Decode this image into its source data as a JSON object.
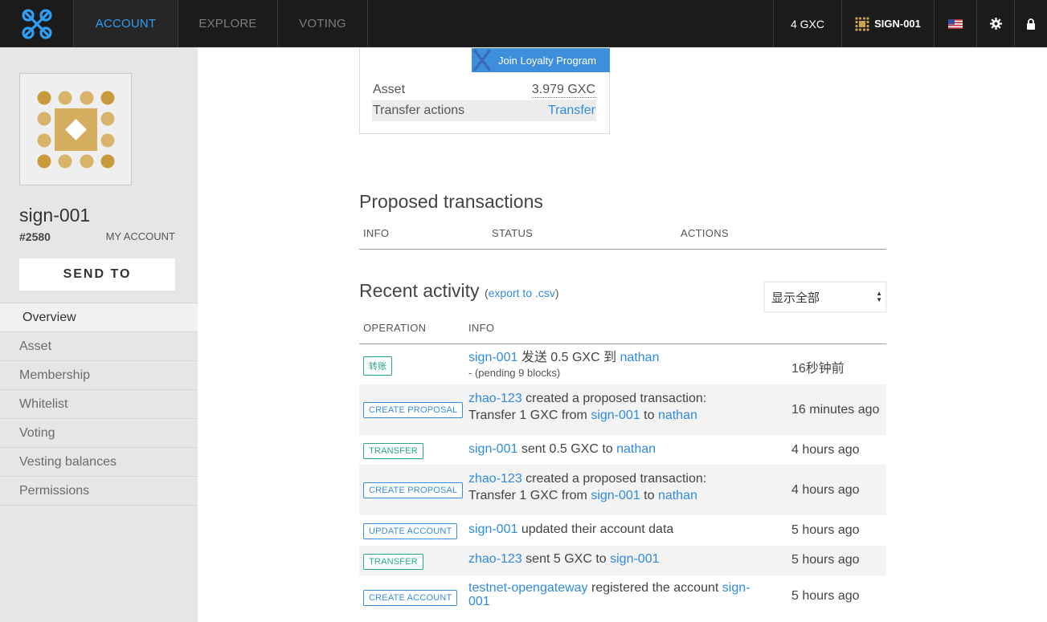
{
  "nav": {
    "tabs": [
      "ACCOUNT",
      "EXPLORE",
      "VOTING"
    ],
    "balance": "4 GXC",
    "account": "SIGN-001"
  },
  "sidebar": {
    "name": "sign-001",
    "id": "#2580",
    "my_account": "MY ACCOUNT",
    "send_to": "SEND TO",
    "menu": [
      "Overview",
      "Asset",
      "Membership",
      "Whitelist",
      "Voting",
      "Vesting balances",
      "Permissions"
    ]
  },
  "card": {
    "loyalty": "Join Loyalty Program",
    "asset_label": "Asset",
    "asset_value": "3.979 GXC",
    "transfer_label": "Transfer actions",
    "transfer_link": "Transfer"
  },
  "proposed": {
    "title": "Proposed transactions",
    "columns": [
      "INFO",
      "STATUS",
      "ACTIONS"
    ]
  },
  "activity": {
    "title": "Recent activity",
    "export_prefix": "(",
    "export_link": "export to .csv",
    "export_suffix": ")",
    "filter": "显示全部",
    "columns": [
      "OPERATION",
      "INFO"
    ],
    "rows": [
      {
        "op": "转账",
        "a": "sign-001",
        "t1": " 发送 0.5 GXC 到 ",
        "b": "nathan",
        "sub": "- (pending 9 blocks)",
        "time": "16秒钟前"
      },
      {
        "op": "CREATE PROPOSAL",
        "a": "zhao-123",
        "t1": " created a proposed transaction:",
        "l2pre": "Transfer 1 GXC from ",
        "b": "sign-001",
        "l2mid": " to ",
        "c": "nathan",
        "time": "16 minutes ago"
      },
      {
        "op": "TRANSFER",
        "a": "sign-001",
        "t1": " sent 0.5 GXC to ",
        "b": "nathan",
        "time": "4 hours ago"
      },
      {
        "op": "CREATE PROPOSAL",
        "a": "zhao-123",
        "t1": " created a proposed transaction:",
        "l2pre": "Transfer 1 GXC from ",
        "b": "sign-001",
        "l2mid": " to ",
        "c": "nathan",
        "time": "4 hours ago"
      },
      {
        "op": "UPDATE ACCOUNT",
        "a": "sign-001",
        "t1": " updated their account data",
        "time": "5 hours ago"
      },
      {
        "op": "TRANSFER",
        "a": "zhao-123",
        "t1": " sent 5 GXC to ",
        "b": "sign-001",
        "time": "5 hours ago"
      },
      {
        "op": "CREATE ACCOUNT",
        "a": "testnet-opengateway",
        "t1": " registered the account ",
        "b1": "sign-",
        "b2": "001",
        "time": "5 hours ago"
      }
    ]
  },
  "colors": {
    "accent": "#2f9ef4",
    "link": "#2f8be0",
    "green": "#27a787",
    "blue": "#3a8cdc",
    "topbar": "#1b1b1b",
    "gold": "#c9a24a"
  }
}
